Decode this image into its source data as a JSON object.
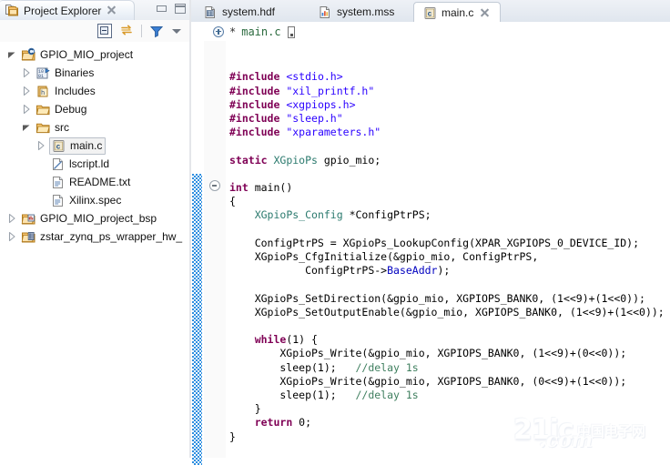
{
  "explorer": {
    "tab_label": "Project Explorer",
    "tab_icon": "project-explorer-icon",
    "close_icon": "close-icon",
    "window_minimize": "minimize-icon",
    "window_maximize": "maximize-icon",
    "toolbar": [
      {
        "name": "collapse-all-icon",
        "tooltip": "Collapse All"
      },
      {
        "name": "link-with-editor-icon",
        "tooltip": "Link with Editor"
      },
      {
        "name": "filter-icon",
        "tooltip": "Filters"
      },
      {
        "name": "view-menu-icon",
        "tooltip": "View Menu"
      }
    ],
    "tree": [
      {
        "label": "GPIO_MIO_project",
        "icon": "c-project-icon",
        "indent": 0,
        "state": "expanded",
        "selected": false
      },
      {
        "label": "Binaries",
        "icon": "binaries-icon",
        "indent": 1,
        "state": "collapsed",
        "selected": false
      },
      {
        "label": "Includes",
        "icon": "includes-icon",
        "indent": 1,
        "state": "collapsed",
        "selected": false
      },
      {
        "label": "Debug",
        "icon": "folder-icon",
        "indent": 1,
        "state": "collapsed",
        "selected": false
      },
      {
        "label": "src",
        "icon": "folder-icon",
        "indent": 1,
        "state": "expanded",
        "selected": false
      },
      {
        "label": "main.c",
        "icon": "c-file-icon",
        "indent": 2,
        "state": "collapsed",
        "selected": true
      },
      {
        "label": "lscript.ld",
        "icon": "linker-script-icon",
        "indent": 2,
        "state": "leaf",
        "selected": false
      },
      {
        "label": "README.txt",
        "icon": "text-file-icon",
        "indent": 2,
        "state": "leaf",
        "selected": false
      },
      {
        "label": "Xilinx.spec",
        "icon": "text-file-icon",
        "indent": 2,
        "state": "leaf",
        "selected": false
      },
      {
        "label": "GPIO_MIO_project_bsp",
        "icon": "bsp-project-icon",
        "indent": 0,
        "state": "collapsed",
        "selected": false
      },
      {
        "label": "zstar_zynq_ps_wrapper_hw_",
        "icon": "hw-project-icon",
        "indent": 0,
        "state": "collapsed",
        "selected": false
      }
    ]
  },
  "editor": {
    "tabs": [
      {
        "label": "system.hdf",
        "icon": "hdf-file-icon",
        "active": false,
        "closable": false
      },
      {
        "label": "system.mss",
        "icon": "mss-file-icon",
        "active": false,
        "closable": false
      },
      {
        "label": "main.c",
        "icon": "c-file-icon",
        "active": true,
        "closable": true
      }
    ],
    "breadcrumb": {
      "expand_icon": "expand-circle-icon",
      "dirty_marker": "*",
      "file": "main.c"
    },
    "gutter": {
      "fold_marker": "fold-collapse-icon",
      "change_bar": "change-bar"
    },
    "code_lines": [
      "",
      "",
      "#include <stdio.h>",
      "#include \"xil_printf.h\"",
      "#include <xgpiops.h>",
      "#include \"sleep.h\"",
      "#include \"xparameters.h\"",
      "",
      "static XGpioPs gpio_mio;",
      "",
      "int main()",
      "{",
      "    XGpioPs_Config *ConfigPtrPS;",
      "",
      "    ConfigPtrPS = XGpioPs_LookupConfig(XPAR_XGPIOPS_0_DEVICE_ID);",
      "    XGpioPs_CfgInitialize(&gpio_mio, ConfigPtrPS,",
      "            ConfigPtrPS->BaseAddr);",
      "",
      "    XGpioPs_SetDirection(&gpio_mio, XGPIOPS_BANK0, (1<<9)+(1<<0));",
      "    XGpioPs_SetOutputEnable(&gpio_mio, XGPIOPS_BANK0, (1<<9)+(1<<0));",
      "",
      "    while(1) {",
      "        XGpioPs_Write(&gpio_mio, XGPIOPS_BANK0, (1<<9)+(0<<0));",
      "        sleep(1);   //delay 1s",
      "        XGpioPs_Write(&gpio_mio, XGPIOPS_BANK0, (0<<9)+(1<<0));",
      "        sleep(1);   //delay 1s",
      "    }",
      "    return 0;",
      "}"
    ],
    "syntax_colors": {
      "keyword": "#7f0055",
      "string": "#2a00ff",
      "comment": "#3f7f5f",
      "type": "#2b7a6e",
      "field": "#0000c0",
      "plain": "#000000"
    }
  },
  "watermark": {
    "brand": "21ic",
    "suffix": ".com",
    "chinese": "中国电子网"
  }
}
